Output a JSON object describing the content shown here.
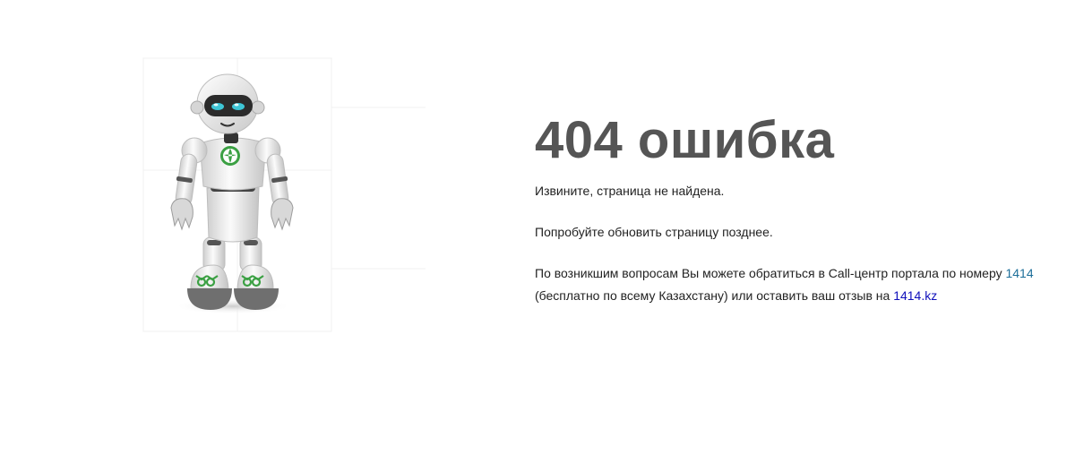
{
  "error": {
    "title": "404 ошибка",
    "message": "Извините, страница не найдена.",
    "retry_hint": "Попробуйте обновить страницу позднее.",
    "contact": {
      "text_before_phone": "По возникшим вопросам Вы можете обратиться в Call-центр портала по номеру ",
      "phone_link": "1414",
      "text_after_phone": " (бесплатно по всему Казахстану) или оставить ваш отзыв на ",
      "site_link": "1414.kz"
    }
  },
  "illustration": {
    "icon": "robot-mascot-icon",
    "colors": {
      "body": "#e6e6e6",
      "visor": "#2b2b2b",
      "eyes": "#3ec6d6",
      "logo_green": "#3ba043",
      "joints": "#555555"
    }
  }
}
